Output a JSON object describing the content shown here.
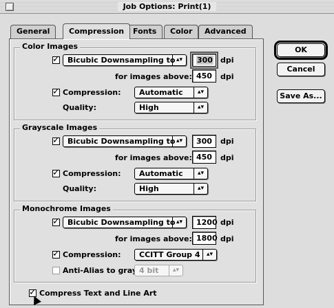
{
  "window": {
    "title": "Job Options: Print(1)"
  },
  "tabs": [
    {
      "label": "General"
    },
    {
      "label": "Compression"
    },
    {
      "label": "Fonts"
    },
    {
      "label": "Color"
    },
    {
      "label": "Advanced"
    }
  ],
  "buttons": {
    "ok": "OK",
    "cancel": "Cancel",
    "save_as": "Save As..."
  },
  "color_images": {
    "title": "Color Images",
    "downsample_checked": true,
    "downsample_method": "Bicubic Downsampling to",
    "resolution": "300",
    "resolution_unit": "dpi",
    "above_label": "for images above:",
    "above_value": "450",
    "above_unit": "dpi",
    "compression_checked": true,
    "compression_label": "Compression:",
    "compression_value": "Automatic",
    "quality_label": "Quality:",
    "quality_value": "High"
  },
  "grayscale_images": {
    "title": "Grayscale Images",
    "downsample_checked": true,
    "downsample_method": "Bicubic Downsampling to",
    "resolution": "300",
    "resolution_unit": "dpi",
    "above_label": "for images above:",
    "above_value": "450",
    "above_unit": "dpi",
    "compression_checked": true,
    "compression_label": "Compression:",
    "compression_value": "Automatic",
    "quality_label": "Quality:",
    "quality_value": "High"
  },
  "monochrome_images": {
    "title": "Monochrome Images",
    "downsample_checked": true,
    "downsample_method": "Bicubic Downsampling to",
    "resolution": "1200",
    "resolution_unit": "dpi",
    "above_label": "for images above:",
    "above_value": "1800",
    "above_unit": "dpi",
    "compression_checked": true,
    "compression_label": "Compression:",
    "compression_value": "CCITT Group 4",
    "antialias_checked": false,
    "antialias_label": "Anti-Alias to gray:",
    "antialias_value": "4 bit"
  },
  "compress_text": {
    "checked": true,
    "label": "Compress Text and Line Art"
  },
  "icons": {
    "popup_arrow": "▴▾"
  }
}
